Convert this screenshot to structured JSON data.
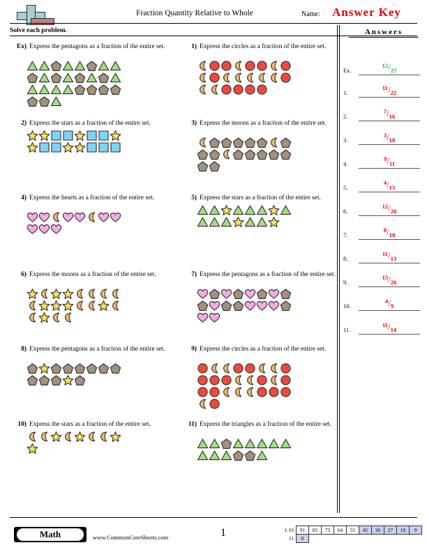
{
  "header": {
    "title": "Fraction Quantity Relative to Whole",
    "name_label": "Name:",
    "answer_key": "Answer Key",
    "instructions": "Solve each problem.",
    "logo_name": "math-logo"
  },
  "answers_column": {
    "heading": "Answers",
    "rows": [
      {
        "label": "Ex.",
        "numerator": "12",
        "denominator": "27",
        "color": "#11aa33"
      },
      {
        "label": "1.",
        "numerator": "11",
        "denominator": "22",
        "color": "#ee0000"
      },
      {
        "label": "2.",
        "numerator": "7",
        "denominator": "16",
        "color": "#ee0000"
      },
      {
        "label": "3.",
        "numerator": "3",
        "denominator": "18",
        "color": "#ee0000"
      },
      {
        "label": "4.",
        "numerator": "9",
        "denominator": "11",
        "color": "#ee0000"
      },
      {
        "label": "5.",
        "numerator": "4",
        "denominator": "15",
        "color": "#ee0000"
      },
      {
        "label": "6.",
        "numerator": "12",
        "denominator": "20",
        "color": "#ee0000"
      },
      {
        "label": "7.",
        "numerator": "8",
        "denominator": "18",
        "color": "#ee0000"
      },
      {
        "label": "8.",
        "numerator": "11",
        "denominator": "13",
        "color": "#ee0000"
      },
      {
        "label": "9.",
        "numerator": "15",
        "denominator": "26",
        "color": "#ee0000"
      },
      {
        "label": "10.",
        "numerator": "4",
        "denominator": "9",
        "color": "#ee0000"
      },
      {
        "label": "11.",
        "numerator": "11",
        "denominator": "14",
        "color": "#ee0000"
      }
    ]
  },
  "problems": [
    {
      "number": "Ex)",
      "text": "Express the pentagons as a fraction of the entire set.",
      "rows": [
        [
          "triangle",
          "triangle",
          "pentagon",
          "triangle",
          "triangle",
          "pentagon",
          "triangle",
          "triangle"
        ],
        [
          "pentagon",
          "triangle",
          "pentagon",
          "triangle",
          "pentagon",
          "triangle",
          "pentagon",
          "triangle"
        ],
        [
          "triangle",
          "triangle",
          "triangle",
          "triangle",
          "pentagon",
          "pentagon",
          "pentagon",
          "pentagon"
        ],
        [
          "pentagon",
          "pentagon",
          "triangle"
        ]
      ]
    },
    {
      "number": "1)",
      "text": "Express the circles as a fraction of the entire set.",
      "rows": [
        [
          "moon",
          "circle",
          "circle",
          "moon",
          "circle",
          "circle",
          "moon",
          "circle"
        ],
        [
          "moon",
          "circle",
          "moon",
          "moon",
          "moon",
          "moon",
          "moon",
          "circle"
        ],
        [
          "moon",
          "moon",
          "circle",
          "circle",
          "circle",
          "circle"
        ]
      ]
    },
    {
      "number": "2)",
      "text": "Express the stars as a fraction of the entire set.",
      "rows": [
        [
          "star",
          "star",
          "square",
          "square",
          "star",
          "square",
          "square",
          "star"
        ],
        [
          "star",
          "square",
          "square",
          "star",
          "star",
          "square",
          "square",
          "square"
        ]
      ]
    },
    {
      "number": "3)",
      "text": "Express the moons as a fraction of the entire set.",
      "rows": [
        [
          "moon",
          "pentagon",
          "pentagon",
          "pentagon",
          "pentagon",
          "pentagon",
          "moon",
          "pentagon"
        ],
        [
          "pentagon",
          "pentagon",
          "moon",
          "pentagon",
          "pentagon",
          "pentagon",
          "pentagon",
          "pentagon"
        ],
        [
          "pentagon",
          "pentagon"
        ]
      ]
    },
    {
      "number": "4)",
      "text": "Express the hearts as a fraction of the entire set.",
      "rows": [
        [
          "heart",
          "heart",
          "moon",
          "heart",
          "heart",
          "moon",
          "heart",
          "heart"
        ],
        [
          "heart",
          "heart",
          "heart"
        ]
      ]
    },
    {
      "number": "5)",
      "text": "Express the stars as a fraction of the entire set.",
      "rows": [
        [
          "triangle",
          "triangle",
          "star",
          "triangle",
          "triangle",
          "triangle",
          "star",
          "triangle"
        ],
        [
          "triangle",
          "triangle",
          "triangle",
          "star",
          "triangle",
          "triangle",
          "star"
        ]
      ]
    },
    {
      "number": "6)",
      "text": "Express the moons as a fraction of the entire set.",
      "rows": [
        [
          "star",
          "moon",
          "star",
          "star",
          "moon",
          "moon",
          "moon",
          "moon"
        ],
        [
          "moon",
          "star",
          "star",
          "star",
          "moon",
          "moon",
          "star",
          "moon"
        ],
        [
          "moon",
          "star",
          "moon",
          "moon"
        ]
      ]
    },
    {
      "number": "7)",
      "text": "Express the pentagons as a fraction of the entire set.",
      "rows": [
        [
          "heart",
          "pentagon",
          "heart",
          "pentagon",
          "heart",
          "pentagon",
          "heart",
          "pentagon"
        ],
        [
          "pentagon",
          "heart",
          "pentagon",
          "pentagon",
          "heart",
          "heart",
          "heart",
          "pentagon"
        ],
        [
          "heart",
          "heart"
        ]
      ]
    },
    {
      "number": "8)",
      "text": "Express the pentagons as a fraction of the entire set.",
      "rows": [
        [
          "pentagon",
          "star",
          "pentagon",
          "pentagon",
          "pentagon",
          "pentagon",
          "pentagon",
          "pentagon"
        ],
        [
          "pentagon",
          "pentagon",
          "pentagon",
          "star",
          "pentagon"
        ]
      ]
    },
    {
      "number": "9)",
      "text": "Express the circles as a fraction of the entire set.",
      "rows": [
        [
          "circle",
          "moon",
          "moon",
          "circle",
          "circle",
          "moon",
          "moon",
          "circle"
        ],
        [
          "circle",
          "circle",
          "circle",
          "moon",
          "moon",
          "circle",
          "moon",
          "circle"
        ],
        [
          "circle",
          "circle",
          "moon",
          "moon",
          "moon",
          "circle",
          "circle",
          "circle"
        ],
        [
          "moon",
          "circle"
        ]
      ]
    },
    {
      "number": "10)",
      "text": "Express the stars as a fraction of the entire set.",
      "rows": [
        [
          "moon",
          "moon",
          "star",
          "moon",
          "star",
          "moon",
          "moon",
          "star"
        ],
        [
          "star"
        ]
      ]
    },
    {
      "number": "11)",
      "text": "Express the triangles as a fraction of the entire set.",
      "rows": [
        [
          "triangle",
          "triangle",
          "pentagon",
          "triangle",
          "triangle",
          "triangle",
          "triangle",
          "triangle"
        ],
        [
          "triangle",
          "triangle",
          "triangle",
          "pentagon",
          "pentagon",
          "triangle"
        ]
      ]
    }
  ],
  "footer": {
    "badge": "Math",
    "website": "www.CommonCoreSheets.com",
    "page_number": "1",
    "score_table": {
      "row1_label": "1-10",
      "row2_label": "11",
      "row1": [
        {
          "value": "91",
          "highlight": false
        },
        {
          "value": "82",
          "highlight": false
        },
        {
          "value": "73",
          "highlight": false
        },
        {
          "value": "64",
          "highlight": false
        },
        {
          "value": "55",
          "highlight": false
        },
        {
          "value": "45",
          "highlight": true
        },
        {
          "value": "36",
          "highlight": true
        },
        {
          "value": "27",
          "highlight": true
        },
        {
          "value": "18",
          "highlight": true
        },
        {
          "value": "9",
          "highlight": true
        }
      ],
      "row2": [
        {
          "value": "0",
          "highlight": true
        }
      ]
    }
  },
  "shape_colors": {
    "triangle": "#9fe07f",
    "pentagon": "#a2917f",
    "circle": "#f0493c",
    "moon": "#f5b96b",
    "star": "#fbe05a",
    "square": "#7fd4f5",
    "heart": "#f7a9e8"
  }
}
